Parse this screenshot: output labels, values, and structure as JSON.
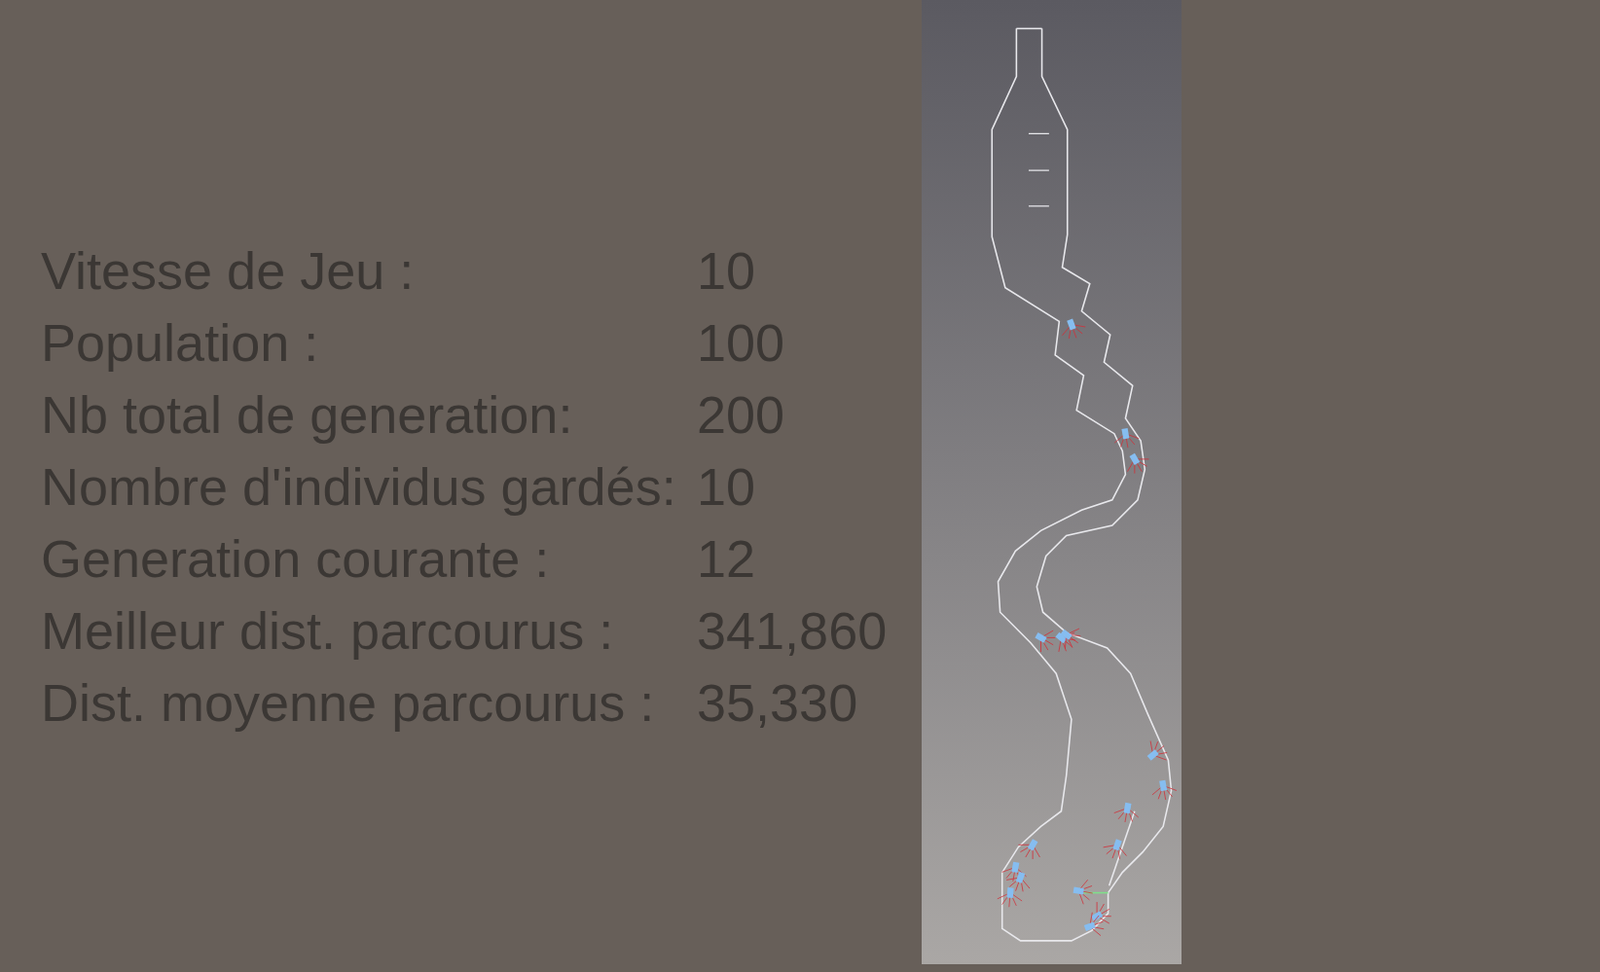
{
  "stats": [
    {
      "label": "Vitesse de Jeu :",
      "value": "10"
    },
    {
      "label": "Population :",
      "value": "100"
    },
    {
      "label": "Nb total de generation:",
      "value": "200"
    },
    {
      "label": "Nombre d'individus gardés:",
      "value": "10"
    },
    {
      "label": "Generation courante :",
      "value": "12"
    },
    {
      "label": "Meilleur dist. parcourus :",
      "value": "341,860"
    },
    {
      "label": "Dist. moyenne parcourus :",
      "value": "35,330"
    }
  ]
}
